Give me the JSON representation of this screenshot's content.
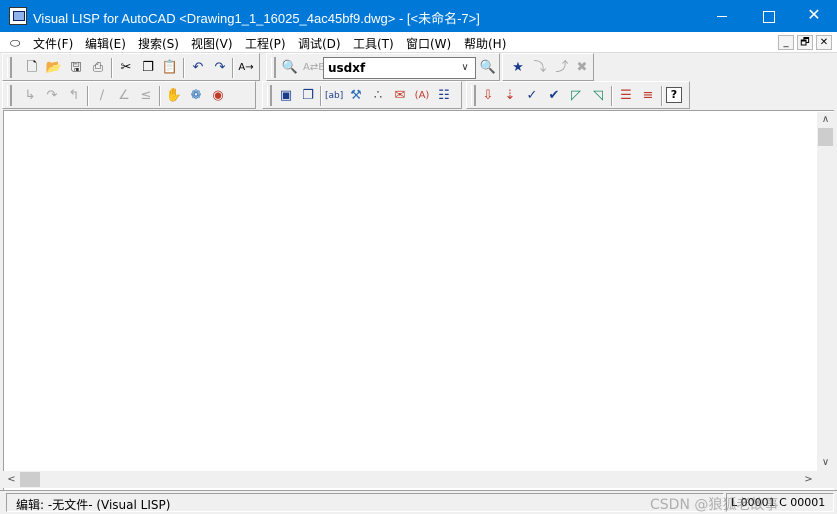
{
  "window": {
    "title": "Visual LISP for AutoCAD <Drawing1_1_16025_4ac45bf9.dwg> - [<未命名-7>]",
    "app_icon": "vlisp-icon",
    "controls": {
      "minimize": "minimize-icon",
      "maximize": "maximize-icon",
      "close": "✕"
    }
  },
  "menubar": {
    "system_icon": "document-icon",
    "items": [
      {
        "label": "文件(F)"
      },
      {
        "label": "编辑(E)"
      },
      {
        "label": "搜索(S)"
      },
      {
        "label": "视图(V)"
      },
      {
        "label": "工程(P)"
      },
      {
        "label": "调试(D)"
      },
      {
        "label": "工具(T)"
      },
      {
        "label": "窗口(W)"
      },
      {
        "label": "帮助(H)"
      }
    ],
    "mdi_controls": [
      "_",
      "🗗",
      "✕"
    ]
  },
  "toolbar": {
    "standard": [
      "new-icon",
      "open-icon",
      "save-icon",
      "print-icon",
      "cut-icon",
      "copy-icon",
      "paste-icon",
      "undo-icon",
      "redo-icon",
      "complete-word-icon"
    ],
    "search": {
      "combo_value": "usdxf",
      "icons": [
        "find-icon",
        "replace-icon",
        "find-toolbar-icon"
      ]
    },
    "bookmarks": [
      "toggle-bookmark-icon",
      "next-bookmark-icon",
      "prev-bookmark-icon"
    ],
    "debug": [
      "step-into-icon",
      "step-over-icon",
      "step-out-icon",
      "continue-icon",
      "quit-icon",
      "reset-icon",
      "toggle-breakpoint-icon",
      "add-watch-icon",
      "last-break-icon"
    ],
    "view": [
      "activate-autocad-icon",
      "select-window-icon",
      "lisp-console-icon",
      "inspect-icon",
      "trace-icon",
      "symbol-service-icon",
      "apropos-icon",
      "watch-window-icon"
    ],
    "tools": [
      "load-active-window-icon",
      "load-selection-icon",
      "check-window-icon",
      "check-selection-icon",
      "format-window-icon",
      "format-selection-icon",
      "comment-icon",
      "uncomment-icon",
      "help-icon"
    ]
  },
  "status": {
    "text": "编辑: -无文件-   (Visual LISP)",
    "position": "L 00001 C 00001",
    "watermark": "CSDN @狼狐老故事"
  }
}
